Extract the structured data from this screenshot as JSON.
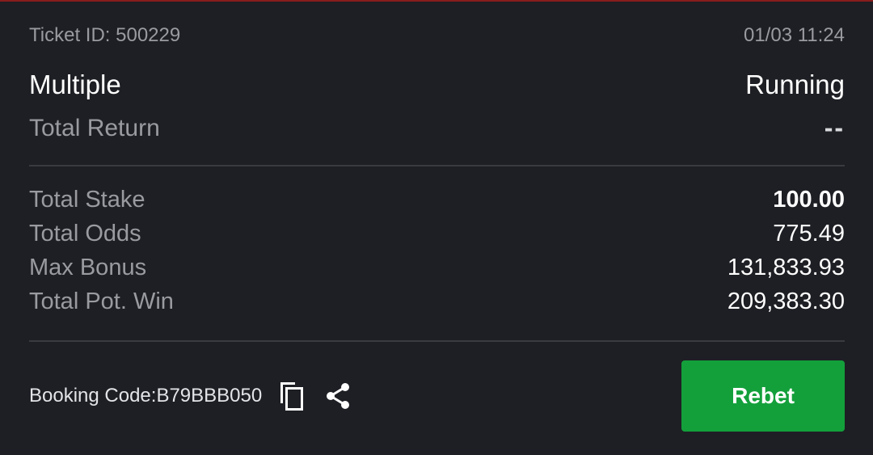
{
  "ticket": {
    "id_label": "Ticket ID: 500229",
    "datetime": "01/03 11:24",
    "bet_type": "Multiple",
    "status": "Running",
    "total_return_label": "Total Return",
    "total_return_value": "--"
  },
  "stats": {
    "stake_label": "Total Stake",
    "stake_value": "100.00",
    "odds_label": "Total Odds",
    "odds_value": "775.49",
    "bonus_label": "Max Bonus",
    "bonus_value": "131,833.93",
    "potwin_label": "Total Pot. Win",
    "potwin_value": "209,383.30"
  },
  "footer": {
    "booking_code_text": "Booking Code:B79BBB050",
    "copy_icon": "copy-icon",
    "share_icon": "share-icon",
    "rebet_label": "Rebet"
  },
  "colors": {
    "background": "#1e1f24",
    "accent_top": "#8a1c1c",
    "rebet_green": "#13a03b",
    "muted_text": "#9a9ba1",
    "divider": "#3a3b41"
  }
}
